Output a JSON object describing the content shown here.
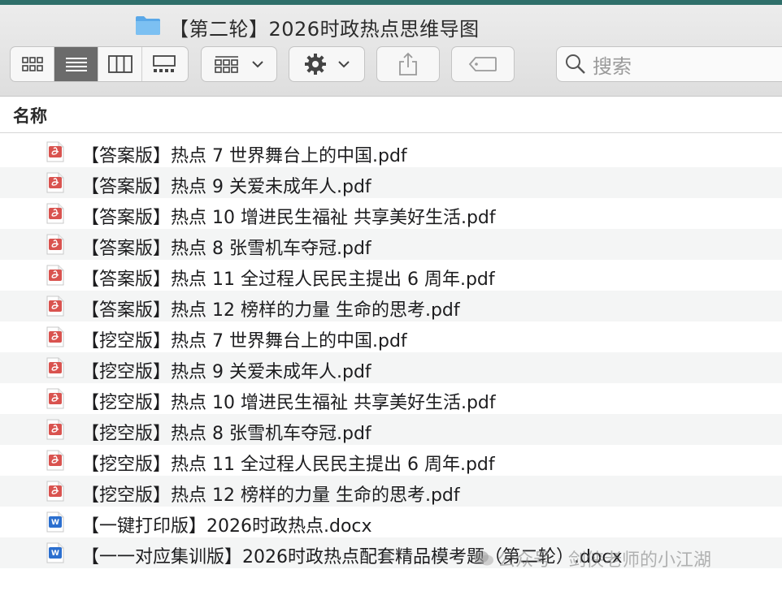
{
  "window": {
    "title": "【第二轮】2026时政热点思维导图"
  },
  "toolbar": {
    "search_placeholder": "搜索"
  },
  "list_header": {
    "name_column": "名称"
  },
  "files": [
    {
      "name": "【答案版】热点 7 世界舞台上的中国.pdf",
      "type": "pdf"
    },
    {
      "name": "【答案版】热点 9 关爱未成年人.pdf",
      "type": "pdf"
    },
    {
      "name": "【答案版】热点 10 增进民生福祉 共享美好生活.pdf",
      "type": "pdf"
    },
    {
      "name": "【答案版】热点 8 张雪机车夺冠.pdf",
      "type": "pdf"
    },
    {
      "name": "【答案版】热点 11  全过程人民民主提出 6 周年.pdf",
      "type": "pdf"
    },
    {
      "name": "【答案版】热点 12 榜样的力量  生命的思考.pdf",
      "type": "pdf"
    },
    {
      "name": "【挖空版】热点 7 世界舞台上的中国.pdf",
      "type": "pdf"
    },
    {
      "name": "【挖空版】热点 9 关爱未成年人.pdf",
      "type": "pdf"
    },
    {
      "name": "【挖空版】热点 10 增进民生福祉 共享美好生活.pdf",
      "type": "pdf"
    },
    {
      "name": "【挖空版】热点 8 张雪机车夺冠.pdf",
      "type": "pdf"
    },
    {
      "name": "【挖空版】热点 11  全过程人民民主提出 6 周年.pdf",
      "type": "pdf"
    },
    {
      "name": "【挖空版】热点 12 榜样的力量  生命的思考.pdf",
      "type": "pdf"
    },
    {
      "name": "【一键打印版】2026时政热点.docx",
      "type": "docx"
    },
    {
      "name": "【一一对应集训版】2026时政热点配套精品模考题（第二轮）.docx",
      "type": "docx"
    }
  ],
  "watermark": {
    "text": "公众号 · 剑侠老师的小江湖"
  },
  "colors": {
    "pdf_icon": "#d9534f",
    "docx_icon": "#2b6fcf",
    "folder": "#5aa8e8",
    "active_view": "#6b6b6b"
  }
}
